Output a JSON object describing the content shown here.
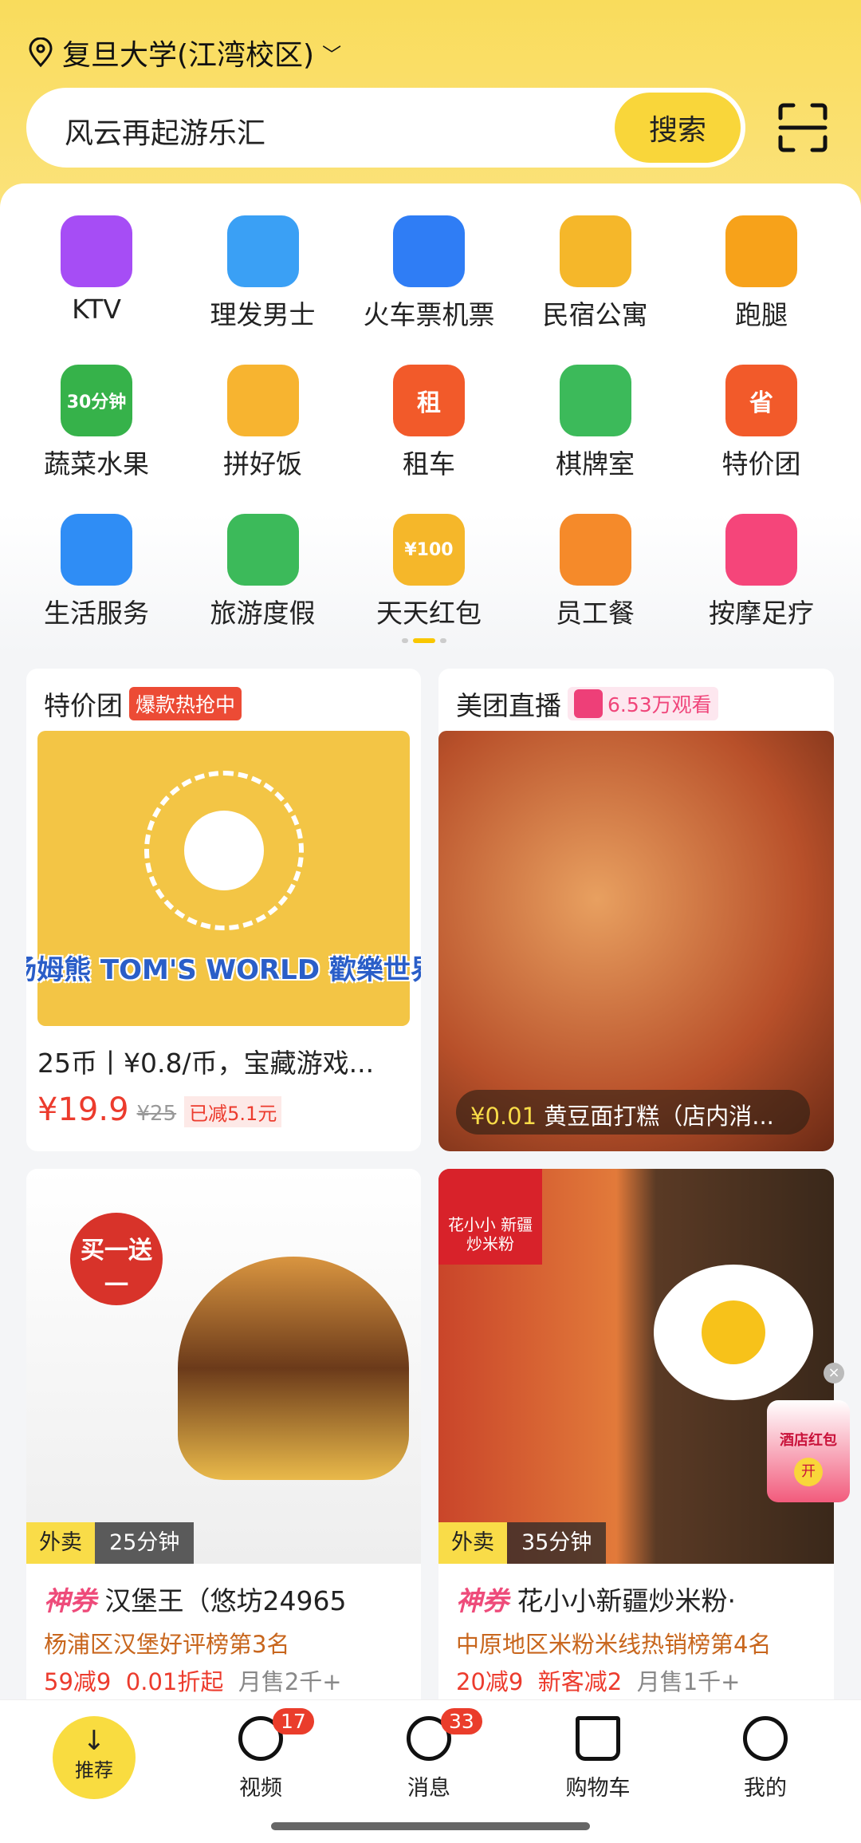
{
  "header": {
    "location": "复旦大学(江湾校区)",
    "search_text": "风云再起游乐汇",
    "search_button": "搜索"
  },
  "categories": [
    {
      "label": "KTV",
      "icon": "microphone-icon",
      "color": "#a64df5"
    },
    {
      "label": "理发男士",
      "icon": "haircut-icon",
      "color": "#3aa0f5"
    },
    {
      "label": "火车票机票",
      "icon": "train-plane-icon",
      "color": "#2f7df5"
    },
    {
      "label": "民宿公寓",
      "icon": "house-icon",
      "color": "#f5b72a"
    },
    {
      "label": "跑腿",
      "icon": "errand-icon",
      "color": "#f7a21a"
    },
    {
      "label": "蔬菜水果",
      "icon": "vegetables-icon",
      "color": "#36b24a",
      "badge": "30分钟"
    },
    {
      "label": "拼好饭",
      "icon": "group-meal-icon",
      "color": "#f7b430"
    },
    {
      "label": "租车",
      "icon": "car-rental-icon",
      "color": "#f25a2a",
      "badge": "租"
    },
    {
      "label": "棋牌室",
      "icon": "mahjong-icon",
      "color": "#3cba5a"
    },
    {
      "label": "特价团",
      "icon": "discount-group-icon",
      "color": "#f25a2a",
      "badge": "省"
    },
    {
      "label": "生活服务",
      "icon": "tools-icon",
      "color": "#2f8df5"
    },
    {
      "label": "旅游度假",
      "icon": "beach-umbrella-icon",
      "color": "#3cba5a"
    },
    {
      "label": "天天红包",
      "icon": "coin-icon",
      "color": "#f5b72a",
      "badge": "¥100"
    },
    {
      "label": "员工餐",
      "icon": "lunchbox-icon",
      "color": "#f58a2a"
    },
    {
      "label": "按摩足疗",
      "icon": "foot-icon",
      "color": "#f5457a"
    }
  ],
  "cards": {
    "deal": {
      "title": "特价团",
      "tag": "爆款热抢中",
      "desc": "25币丨¥0.8/币，宝藏游戏...",
      "price": "¥19.9",
      "original": "¥25",
      "saved": "已减5.1元",
      "brand": "汤姆熊 TOM'S WORLD 歡樂世界"
    },
    "live": {
      "title": "美团直播",
      "viewers": "6.53万观看",
      "price": "¥0.01",
      "item": "黄豆面打糕（店内消..."
    },
    "shops": [
      {
        "promo_badge": "买一送一",
        "type": "外卖",
        "time": "25分钟",
        "coupon": "神券",
        "name": "汉堡王（悠坊24965",
        "rank": "杨浦区汉堡好评榜第3名",
        "offers": [
          "59减9",
          "0.01折起"
        ],
        "sales": "月售2千+"
      },
      {
        "type": "外卖",
        "time": "35分钟",
        "coupon": "神券",
        "name": "花小小新疆炒米粉·",
        "rank": "中原地区米粉米线热销榜第4名",
        "offers": [
          "20减9",
          "新客减2"
        ],
        "sales": "月售1千+",
        "brand": "花小小 新疆炒米粉"
      }
    ]
  },
  "float_ad": {
    "label": "酒店红包",
    "button": "开"
  },
  "nav": [
    {
      "label": "推荐"
    },
    {
      "label": "视频",
      "badge": "17"
    },
    {
      "label": "消息",
      "badge": "33"
    },
    {
      "label": "购物车"
    },
    {
      "label": "我的"
    }
  ]
}
